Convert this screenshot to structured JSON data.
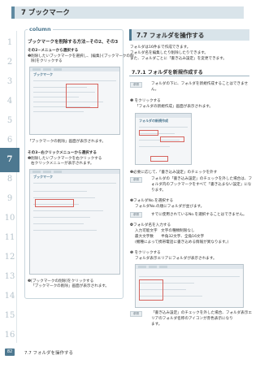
{
  "chapter_header": "7 ブックマーク",
  "tabs": [
    "1",
    "2",
    "3",
    "4",
    "5",
    "6",
    "7",
    "8",
    "9",
    "10",
    "11",
    "12",
    "13",
    "14",
    "15",
    "16"
  ],
  "active_tab": "7",
  "column": {
    "tag": "column",
    "title": "ブックマークを削除する方法−その2、その3",
    "step1_heading": "その2−メニューから選択する",
    "step1_line1": "❶削除したいブックマークを選択し、[編集]-[ブックマークの削",
    "step1_line2": "除]をクリックする",
    "shot1_title": "ブックマーク",
    "caption1": "「ブックマークの削除」画面が表示されます。",
    "step2_heading": "その3−右クリックメニューから選択する",
    "step2_line1": "❶削除したいブックマークを右クリックする",
    "step2_line2": "右クリックメニューが表示されます。",
    "shot2_title": "ブックマーク",
    "step3_line1": "❷[ブックマークの削除]をクリックする",
    "step3_line2": "「ブックマークの削除」画面が表示されます。"
  },
  "section": {
    "title": "7.7 フォルダを操作する",
    "intro1": "フォルダは16件まで作成できます。",
    "intro2": "フォルダ名を編集したり削除したりできます。",
    "intro3": "また、フォルダごとに「書き込み設定」を変更できます。",
    "sub_title": "7.7.1 フォルダを新規作成する",
    "note_label": "参照",
    "note1_line1": "フォルダの下に、フォルダを新規作成することはできませ",
    "note1_line2": "ん。",
    "step1_line1": "❶ をクリックする",
    "step1_line2": "「フォルダの新規作成」画面が表示されます。",
    "shot_title": "フォルダの新規作成",
    "step2_line1": "❷必要に応じて、「書き込み設定」のチェックを外す",
    "note2_line1": "フォルダの「書き込み設定」のチェックを外した場合は、フ",
    "note2_line2": "ォルダ内のブックマークをすべて「書き込まない設定」にな",
    "note2_line3": "ります。",
    "step3_line1": "❸フォルダNo.を選択する",
    "step3_line2": "フォルダNo.の順にフォルダが並びます。",
    "note3_line1": "すでに使用されているNo.を選択することはできません。",
    "step4_line1": "❹フォルダ名を入力する",
    "step4_line2": "入力可能文字　文字の種類制限なし",
    "step4_line3": "最大文字数　　半角32文字、全角16文字",
    "step4_line4": "(機種によって携帯電話に書き込める情報が異なります。)",
    "step5_line1": "❺ をクリックする",
    "step5_line2": "フォルダ表示エリアにフォルダが表示されます。",
    "note5_line1": "「書き込み設定」のチェックを外した場合、フォルダ表示エ",
    "note5_line2": "リアのフォルダ名称のアイコンが赤色表示になり",
    "note5_line3": "ます。"
  },
  "footer": {
    "page_number": "82",
    "text": "7.7 フォルダを操作する"
  },
  "colors": {
    "accent": "#4d7890",
    "header_bg": "#d9e4ea",
    "highlight": "#d6635d"
  }
}
